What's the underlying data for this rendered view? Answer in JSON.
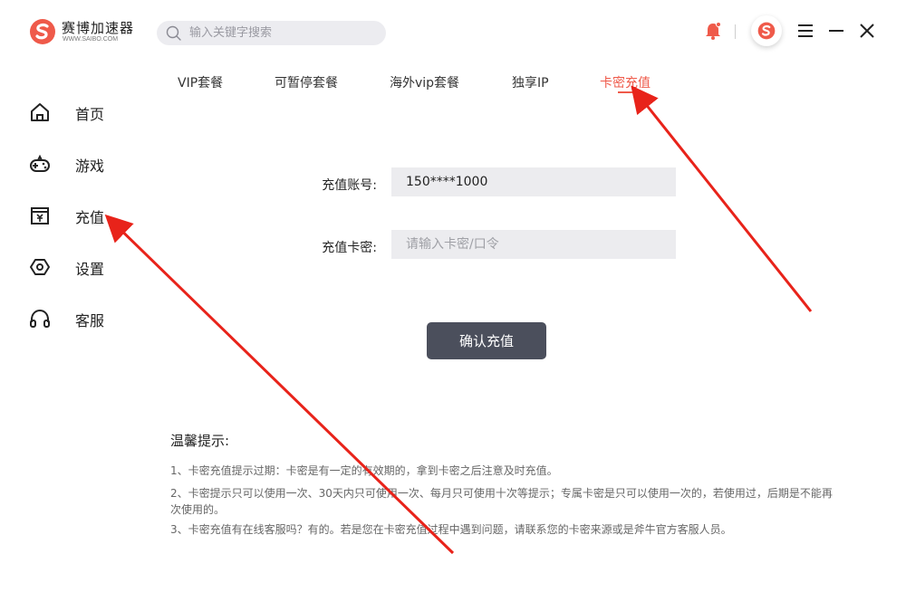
{
  "app": {
    "brand_name": "赛博加速器",
    "brand_sub": "WWW.SAIBO.COM",
    "search_placeholder": "输入关键字搜索"
  },
  "icons": {
    "logo": "saibo-logo-icon",
    "search": "search-icon",
    "bell": "bell-icon",
    "menu": "menu-icon",
    "minimize": "minimize-icon",
    "close": "close-icon"
  },
  "sidebar": {
    "items": [
      {
        "label": "首页",
        "icon": "home-icon"
      },
      {
        "label": "游戏",
        "icon": "gamepad-icon"
      },
      {
        "label": "充值",
        "icon": "recharge-icon"
      },
      {
        "label": "设置",
        "icon": "settings-icon"
      },
      {
        "label": "客服",
        "icon": "headset-icon"
      }
    ]
  },
  "tabs": {
    "items": [
      "VIP套餐",
      "可暂停套餐",
      "海外vip套餐",
      "独享IP",
      "卡密充值"
    ],
    "active": "卡密充值"
  },
  "form": {
    "account_label": "充值账号:",
    "account_value": "150****1000",
    "card_label": "充值卡密:",
    "card_placeholder": "请输入卡密/口令",
    "card_value": "",
    "confirm_label": "确认充值"
  },
  "tips": {
    "title": "温馨提示:",
    "lines": [
      "1、卡密充值提示过期：卡密是有一定的有效期的，拿到卡密之后注意及时充值。",
      "2、卡密提示只可以使用一次、30天内只可使用一次、每月只可使用十次等提示；专属卡密是只可以使用一次的，若使用过，后期是不能再次使用的。",
      "3、卡密充值有在线客服吗？有的。若是您在卡密充值过程中遇到问题，请联系您的卡密来源或是斧牛官方客服人员。"
    ]
  },
  "colors": {
    "accent": "#ef5a4a",
    "button_bg": "#4b4f5c",
    "field_bg": "#ececef",
    "annotation": "#e8231a"
  }
}
